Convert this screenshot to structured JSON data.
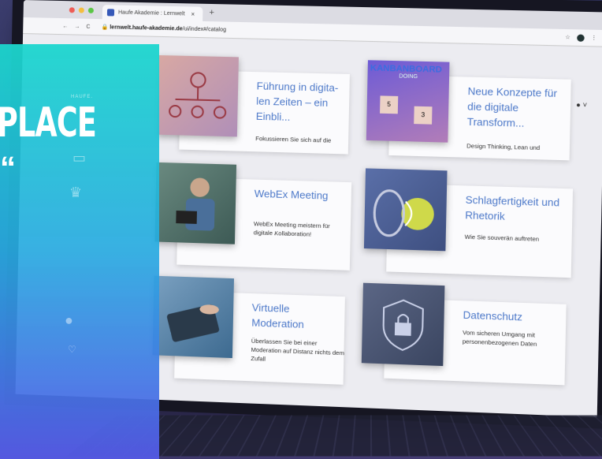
{
  "browser": {
    "tab_title": "Haufe Akademie : Lernwelt",
    "tab_close": "×",
    "new_tab": "+",
    "url_host": "lernwelt.haufe-akademie.de",
    "url_path": "/ui/index#/catalog"
  },
  "nav": {
    "back": "←",
    "forward": "→",
    "reload": "C"
  },
  "app": {
    "logo": "HAUFE."
  },
  "overlay": {
    "headline": "PLACE",
    "quote": "“"
  },
  "cards": [
    {
      "title": "Führung in digita-len Zeiten – ein Einbli...",
      "desc": "Fokussieren Sie sich auf die"
    },
    {
      "title": "Neue Konzepte für die digitale Transform...",
      "desc": "Design Thinking, Lean und",
      "img_heading": "KANBANBOARD",
      "img_sub": "DOING"
    },
    {
      "title": "WebEx Meeting",
      "desc": "WebEx Meeting meistern für digitale Kollaboration!"
    },
    {
      "title": "Schlagfertigkeit und Rhetorik",
      "desc": "Wie Sie souverän auftreten"
    },
    {
      "title": "Virtuelle Moderation",
      "desc": "Überlassen Sie bei einer Moderation auf Distanz nichts dem Zufall"
    },
    {
      "title": "Datenschutz",
      "desc": "Vom sicheren Umgang mit personenbezogenen Daten"
    }
  ],
  "colors": {
    "overlay_top": "#1cd6cd",
    "overlay_bottom": "#555ae6",
    "card_title": "#4d79c9"
  }
}
